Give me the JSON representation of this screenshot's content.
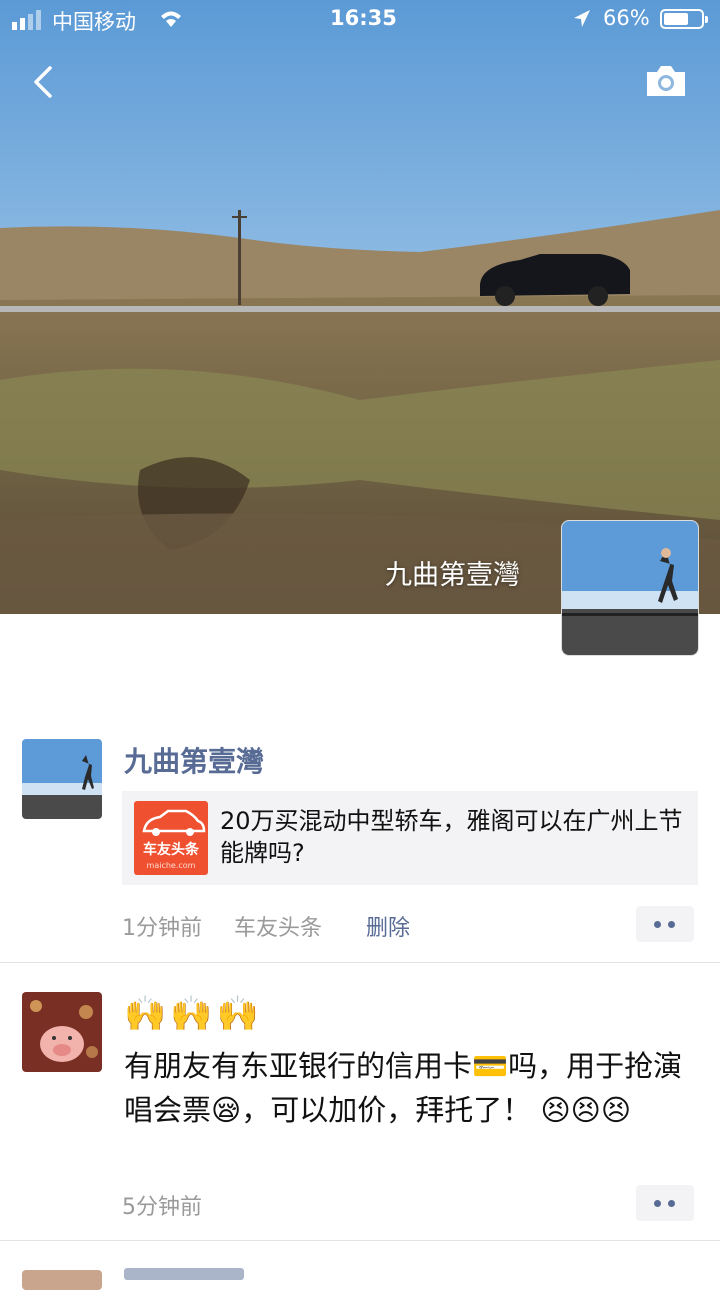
{
  "status_bar": {
    "carrier": "中国移动",
    "time": "16:35",
    "battery_pct": "66%",
    "battery_level": 0.66
  },
  "header": {
    "back_icon": "chevron-left-icon",
    "camera_icon": "camera-icon"
  },
  "cover": {
    "name": "九曲第壹灣"
  },
  "posts": [
    {
      "author": "九曲第壹灣",
      "share": {
        "logo_text": "车友头条",
        "logo_url_text": "maiche.com",
        "title": "20万买混动中型轿车，雅阁可以在广州上节能牌吗?"
      },
      "time": "1分钟前",
      "source": "车友头条",
      "delete_label": "删除"
    },
    {
      "emoji_line": "🙌🙌🙌",
      "text": "有朋友有东亚银行的信用卡💳吗，用于抢演唱会票😪，可以加价，拜托了！ 😣😣😣",
      "time": "5分钟前"
    }
  ],
  "colors": {
    "link": "#576b95",
    "meta": "#9a9a9a",
    "share_bg": "#f3f3f5"
  }
}
